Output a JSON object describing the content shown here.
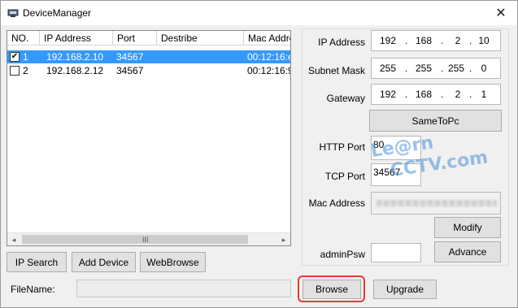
{
  "window": {
    "title": "DeviceManager",
    "close_glyph": "✕"
  },
  "list": {
    "columns": [
      "NO.",
      "IP Address",
      "Port",
      "Destribe",
      "Mac Addre"
    ],
    "rows": [
      {
        "no": "1",
        "ip": "192.168.2.10",
        "port": "34567",
        "describe": "",
        "mac": "00:12:16:e",
        "checked": true,
        "selected": true
      },
      {
        "no": "2",
        "ip": "192.168.2.12",
        "port": "34567",
        "describe": "",
        "mac": "00:12:16:9",
        "checked": false,
        "selected": false
      }
    ],
    "scroll": {
      "left": "◂",
      "right": "▸",
      "grip": "III"
    }
  },
  "buttons": {
    "ip_search": "IP Search",
    "add_device": "Add Device",
    "web_browse": "WebBrowse",
    "same_to_pc": "SameToPc",
    "modify": "Modify",
    "advance": "Advance",
    "browse": "Browse",
    "upgrade": "Upgrade"
  },
  "config": {
    "ip_label": "IP Address",
    "ip": [
      "192",
      "168",
      "2",
      "10"
    ],
    "mask_label": "Subnet Mask",
    "mask": [
      "255",
      "255",
      "255",
      "0"
    ],
    "gateway_label": "Gateway",
    "gateway": [
      "192",
      "168",
      "2",
      "1"
    ],
    "http_label": "HTTP Port",
    "http_port": "80",
    "tcp_label": "TCP Port",
    "tcp_port": "34567",
    "mac_label": "Mac Address",
    "admin_label": "adminPsw",
    "admin_psw": ""
  },
  "bottom": {
    "filename_label": "FileName:",
    "filename_value": ""
  },
  "watermark": {
    "line1": "Le@rn",
    "line2": "CCTV.com"
  },
  "colors": {
    "selection": "#3399ff",
    "highlight": "#e53935",
    "watermark": "#4a90d9"
  }
}
